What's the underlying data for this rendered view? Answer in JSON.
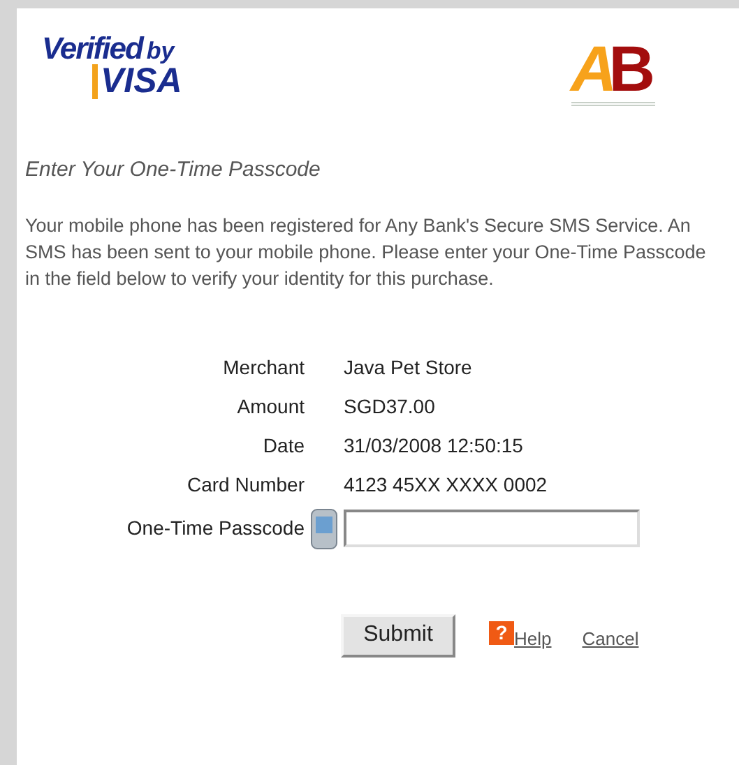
{
  "logos": {
    "verified_line1": "Verified",
    "verified_line2": "by",
    "visa": "VISA",
    "bank": [
      "A",
      "B"
    ]
  },
  "heading": "Enter Your One-Time Passcode",
  "message": "Your mobile phone has been registered for Any Bank's Secure SMS Service. An SMS has been sent to your mobile phone. Please enter your One-Time Passcode in the field below to verify your identity for this purchase.",
  "details": [
    {
      "label": "Merchant",
      "value": "Java Pet Store"
    },
    {
      "label": "Amount",
      "value": "SGD37.00"
    },
    {
      "label": "Date",
      "value": "31/03/2008 12:50:15"
    },
    {
      "label": "Card Number",
      "value": "4123 45XX XXXX 0002"
    }
  ],
  "passcode": {
    "label": "One-Time Passcode"
  },
  "submit": "Submit",
  "help": {
    "icon": "?",
    "label": "Help"
  },
  "cancel": "Cancel"
}
